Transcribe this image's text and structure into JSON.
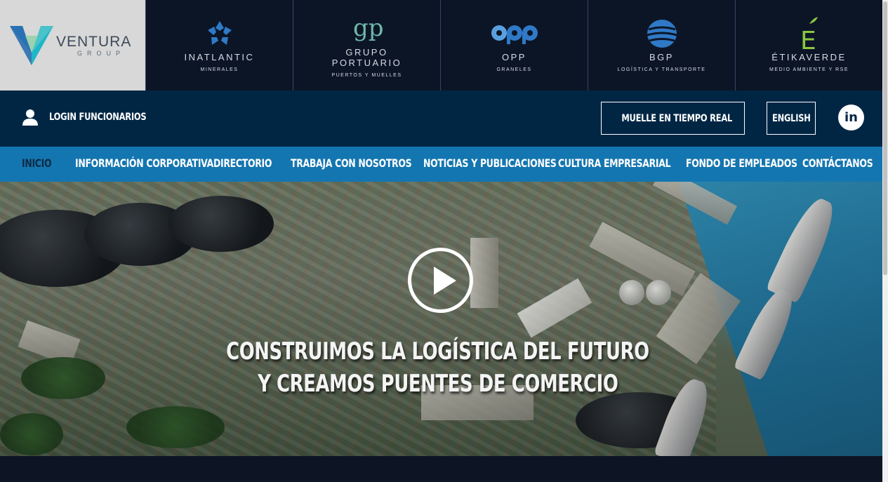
{
  "brand": {
    "logo_name": "VENTURA",
    "logo_sub": "GROUP"
  },
  "companies": [
    {
      "name": "INATLANTIC",
      "sub": "MINERALES",
      "icon": "inatlantic-logo-icon",
      "color": "#2f79c6"
    },
    {
      "name": "GRUPO\nPORTUARIO",
      "sub": "PUERTOS Y MUELLES",
      "icon": "gp-logo-icon",
      "color": "#6fb8a8"
    },
    {
      "name": "OPP",
      "sub": "GRANELES",
      "icon": "opp-logo-icon",
      "color": "#2f79c6"
    },
    {
      "name": "BGP",
      "sub": "LOGÍSTICA Y TRANSPORTE",
      "icon": "bgp-logo-icon",
      "color": "#2f79c6"
    },
    {
      "name": "ÉTIKAVERDE",
      "sub": "MEDIO AMBIENTE Y RSE",
      "icon": "etikaverde-logo-icon",
      "color": "#8cc63f"
    }
  ],
  "utility": {
    "login_label": "LOGIN FUNCIONARIOS",
    "muelle_label": "MUELLE EN TIEMPO REAL",
    "english_label": "ENGLISH",
    "linkedin_text": "in"
  },
  "nav": [
    {
      "label": "INICIO",
      "active": true
    },
    {
      "label": "INFORMACIÓN CORPORATIVA"
    },
    {
      "label": "DIRECTORIO"
    },
    {
      "label": "TRABAJA CON NOSOTROS"
    },
    {
      "label": "NOTICIAS Y PUBLICACIONES"
    },
    {
      "label": "CULTURA EMPRESARIAL"
    },
    {
      "label": "FONDO DE EMPLEADOS"
    },
    {
      "label": "CONTÁCTANOS"
    }
  ],
  "hero": {
    "line1": "CONSTRUIMOS LA LOGÍSTICA DEL FUTURO",
    "line2": "Y CREAMOS PUENTES DE COMERCIO"
  },
  "colors": {
    "brandbar": "#0c1526",
    "utilbar": "#012644",
    "nav": "#1476b0",
    "nav_active": "#0b2a46"
  }
}
